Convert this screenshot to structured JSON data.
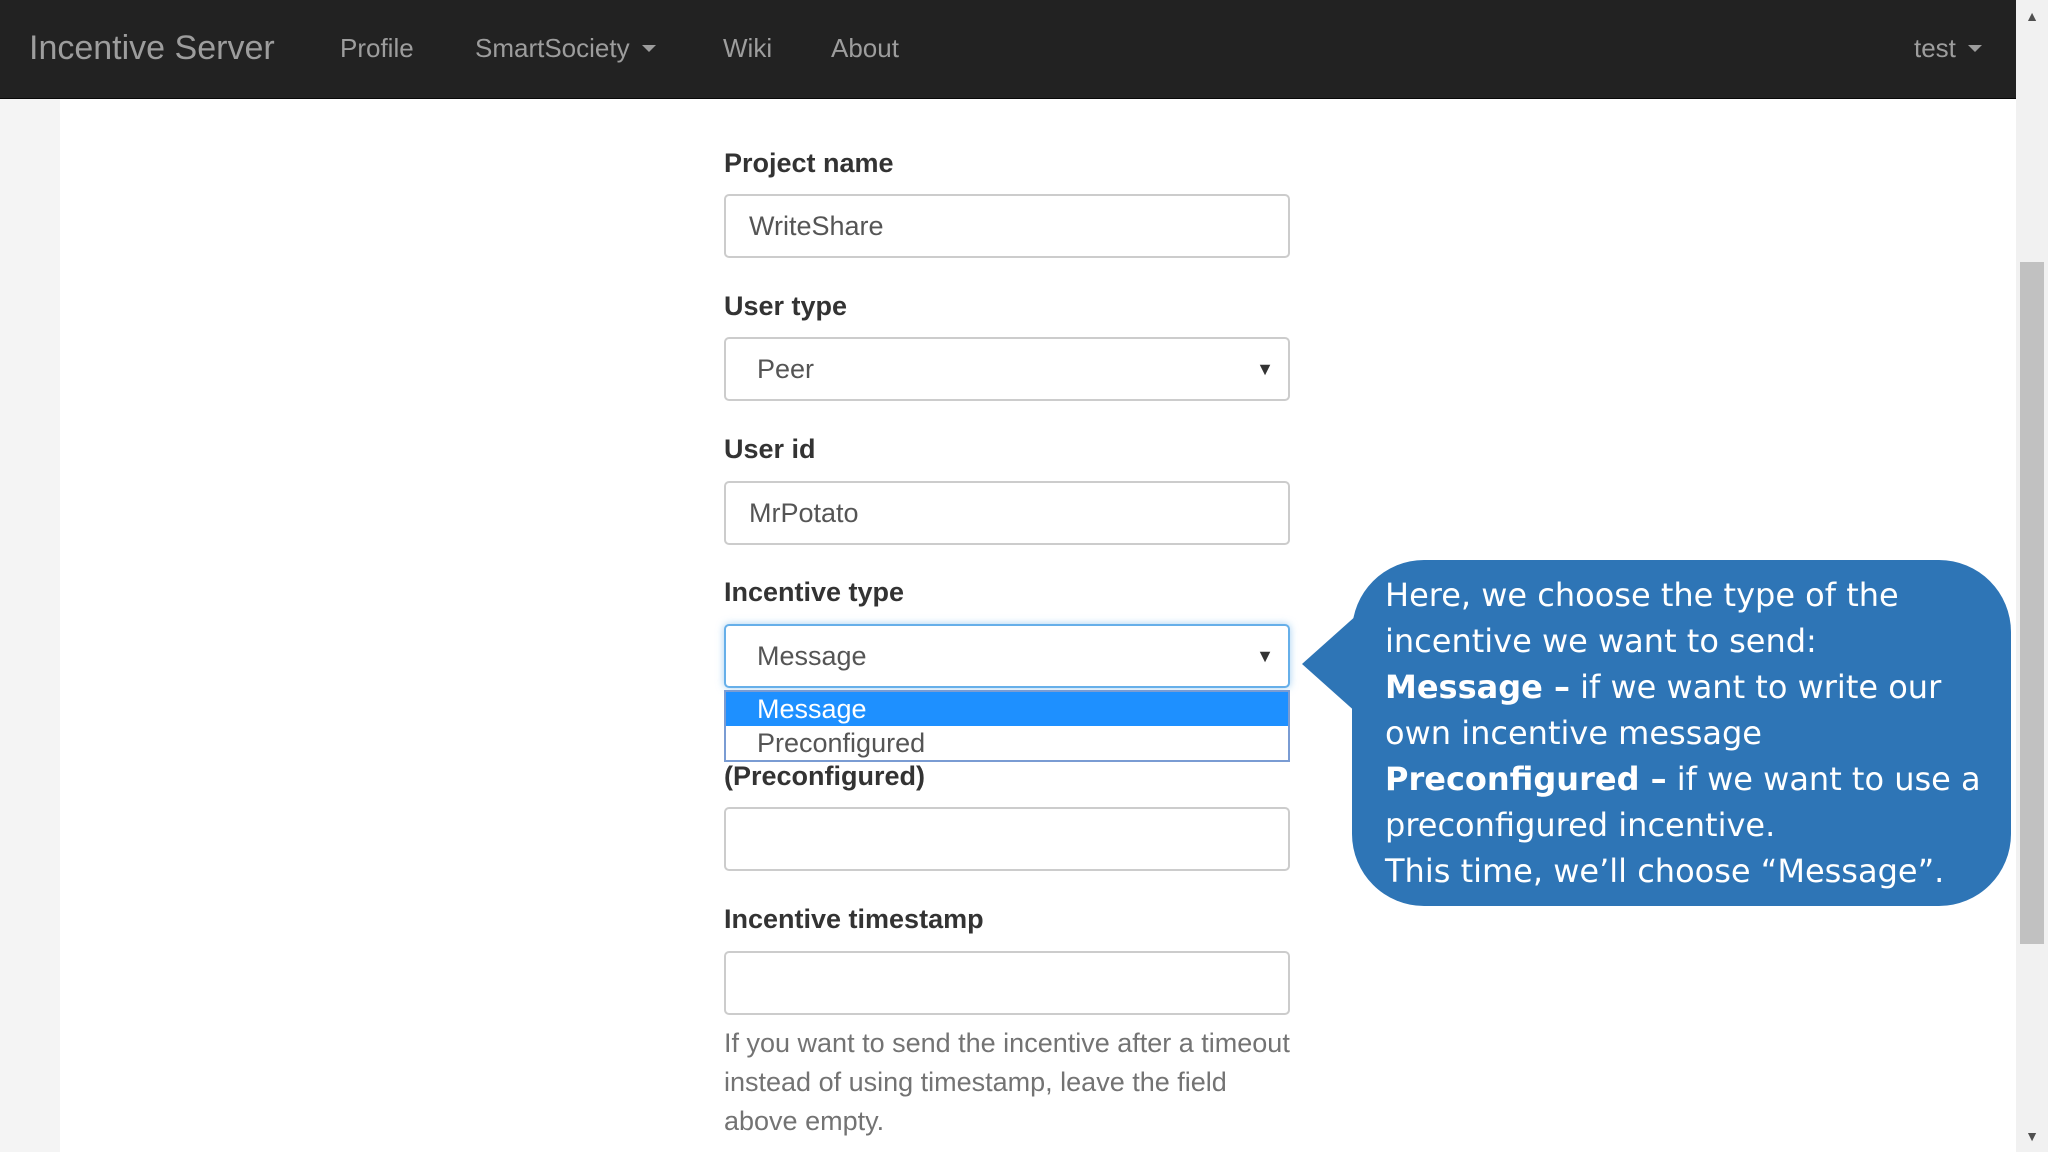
{
  "navbar": {
    "brand": "Incentive Server",
    "links": [
      "Profile",
      "SmartSociety",
      "Wiki",
      "About"
    ],
    "user_menu": "test"
  },
  "form": {
    "project_name": {
      "label": "Project name",
      "value": "WriteShare"
    },
    "user_type": {
      "label": "User type",
      "value": "Peer"
    },
    "user_id": {
      "label": "User id",
      "value": "MrPotato"
    },
    "incentive_type": {
      "label": "Incentive type",
      "value": "Message",
      "options": [
        "Message",
        "Preconfigured"
      ]
    },
    "preconfigured": {
      "label_visible_part": "(Preconfigured)",
      "value": ""
    },
    "incentive_timestamp": {
      "label": "Incentive timestamp",
      "value": ""
    },
    "help_text": "If you want to send the incentive after a timeout instead of using timestamp, leave the field above empty."
  },
  "callout": {
    "line1": "Here, we choose the type of the incentive we want to send:",
    "message_term": "Message –",
    "message_desc": " if we want to write our own incentive message",
    "preconfigured_term": "Preconfigured –",
    "preconfigured_desc": " if we want to use a preconfigured incentive.",
    "closing": "This time, we’ll choose “Message”.",
    "color": "#2e75b6"
  },
  "colors": {
    "navbar_bg": "#222222",
    "navbar_text": "#9d9d9d",
    "selected_option": "#1e90ff"
  }
}
